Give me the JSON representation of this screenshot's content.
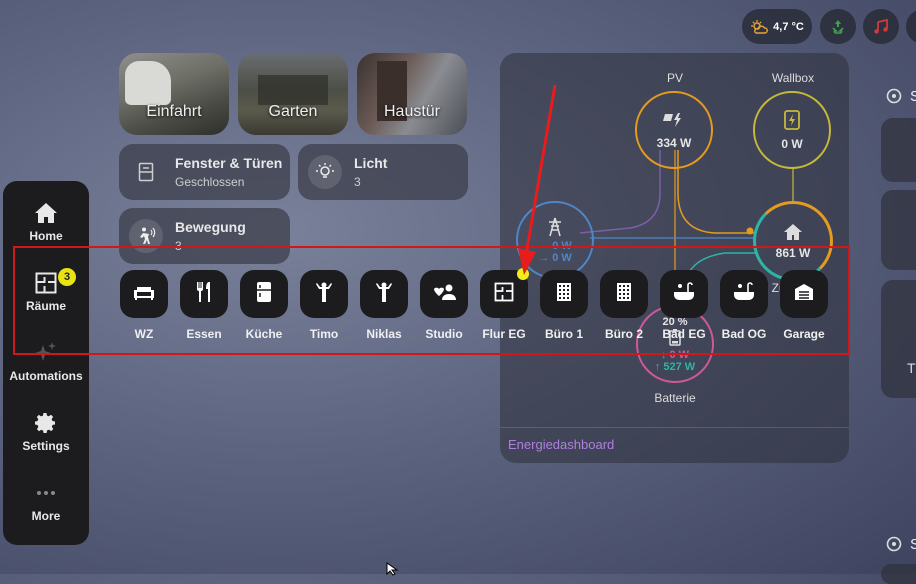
{
  "header": {
    "weather": "4,7 °C"
  },
  "cameras": [
    {
      "label": "Einfahrt"
    },
    {
      "label": "Garten"
    },
    {
      "label": "Haustür"
    }
  ],
  "tiles": {
    "windows": {
      "title": "Fenster & Türen",
      "state": "Geschlossen"
    },
    "light": {
      "title": "Licht",
      "state": "3"
    },
    "motion": {
      "title": "Bewegung",
      "state": "3"
    }
  },
  "nav": {
    "home": "Home",
    "rooms": "Räume",
    "rooms_badge": "3",
    "automations": "Automations",
    "settings": "Settings",
    "more": "More"
  },
  "energy": {
    "pv_label": "PV",
    "pv_value": "334 W",
    "wallbox_label": "Wallbox",
    "wallbox_value": "0 W",
    "grid_in": "0 W",
    "grid_out": "0 W",
    "home_value": "861 W",
    "home_label": "Zuhause",
    "battery_percent": "20 %",
    "battery_in": "0 W",
    "battery_out": "527 W",
    "battery_label": "Batterie",
    "link": "Energiedashboard",
    "colors": {
      "pv": "#e59b1e",
      "wallbox": "#c5b93c",
      "grid": "#4f86c6",
      "home": "#2fb5a3",
      "battery": "#d0589a",
      "link": "#b07fe0"
    }
  },
  "rooms": [
    {
      "label": "WZ",
      "icon": "sofa-icon"
    },
    {
      "label": "Essen",
      "icon": "cutlery-icon"
    },
    {
      "label": "Küche",
      "icon": "fridge-icon"
    },
    {
      "label": "Timo",
      "icon": "person-icon"
    },
    {
      "label": "Niklas",
      "icon": "person-icon"
    },
    {
      "label": "Studio",
      "icon": "people-icon"
    },
    {
      "label": "Flur EG",
      "icon": "floorplan-icon"
    },
    {
      "label": "Büro 1",
      "icon": "office-building-icon"
    },
    {
      "label": "Büro 2",
      "icon": "office-building-icon"
    },
    {
      "label": "Bad EG",
      "icon": "bathtub-icon"
    },
    {
      "label": "Bad OG",
      "icon": "bathtub-icon"
    },
    {
      "label": "Garage",
      "icon": "garage-icon"
    }
  ],
  "right_side": {
    "section1_initial": "S",
    "card_initial": "T",
    "section2_initial": "S"
  }
}
